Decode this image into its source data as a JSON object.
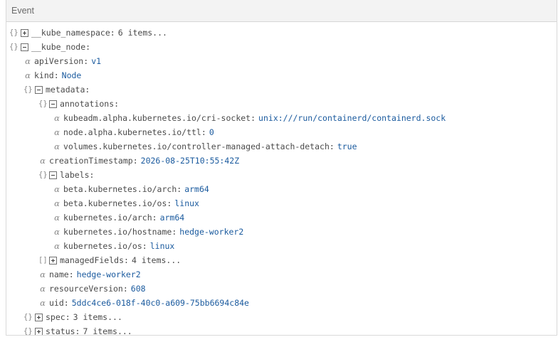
{
  "header": {
    "title": "Event"
  },
  "tree": {
    "kube_namespace": {
      "key": "__kube_namespace",
      "count": "6 items..."
    },
    "kube_node": {
      "key": "__kube_node",
      "apiVersion": {
        "key": "apiVersion",
        "value": "v1"
      },
      "kind": {
        "key": "kind",
        "value": "Node"
      },
      "metadata": {
        "key": "metadata",
        "annotations": {
          "key": "annotations",
          "cri_socket": {
            "key": "kubeadm.alpha.kubernetes.io/cri-socket",
            "value": "unix:///run/containerd/containerd.sock"
          },
          "ttl": {
            "key": "node.alpha.kubernetes.io/ttl",
            "value": "0"
          },
          "attach_detach": {
            "key": "volumes.kubernetes.io/controller-managed-attach-detach",
            "value": "true"
          }
        },
        "creationTimestamp": {
          "key": "creationTimestamp",
          "value": "2026-08-25T10:55:42Z"
        },
        "labels": {
          "key": "labels",
          "beta_arch": {
            "key": "beta.kubernetes.io/arch",
            "value": "arm64"
          },
          "beta_os": {
            "key": "beta.kubernetes.io/os",
            "value": "linux"
          },
          "arch": {
            "key": "kubernetes.io/arch",
            "value": "arm64"
          },
          "hostname": {
            "key": "kubernetes.io/hostname",
            "value": "hedge-worker2"
          },
          "os": {
            "key": "kubernetes.io/os",
            "value": "linux"
          }
        },
        "managedFields": {
          "key": "managedFields",
          "count": "4 items..."
        },
        "name": {
          "key": "name",
          "value": "hedge-worker2"
        },
        "resourceVersion": {
          "key": "resourceVersion",
          "value": "608"
        },
        "uid": {
          "key": "uid",
          "value": "5ddc4ce6-018f-40c0-a609-75bb6694c84e"
        }
      },
      "spec": {
        "key": "spec",
        "count": "3 items..."
      },
      "status": {
        "key": "status",
        "count": "7 items..."
      }
    }
  },
  "icons": {
    "object": "{}",
    "array": "[]",
    "string": "α"
  }
}
